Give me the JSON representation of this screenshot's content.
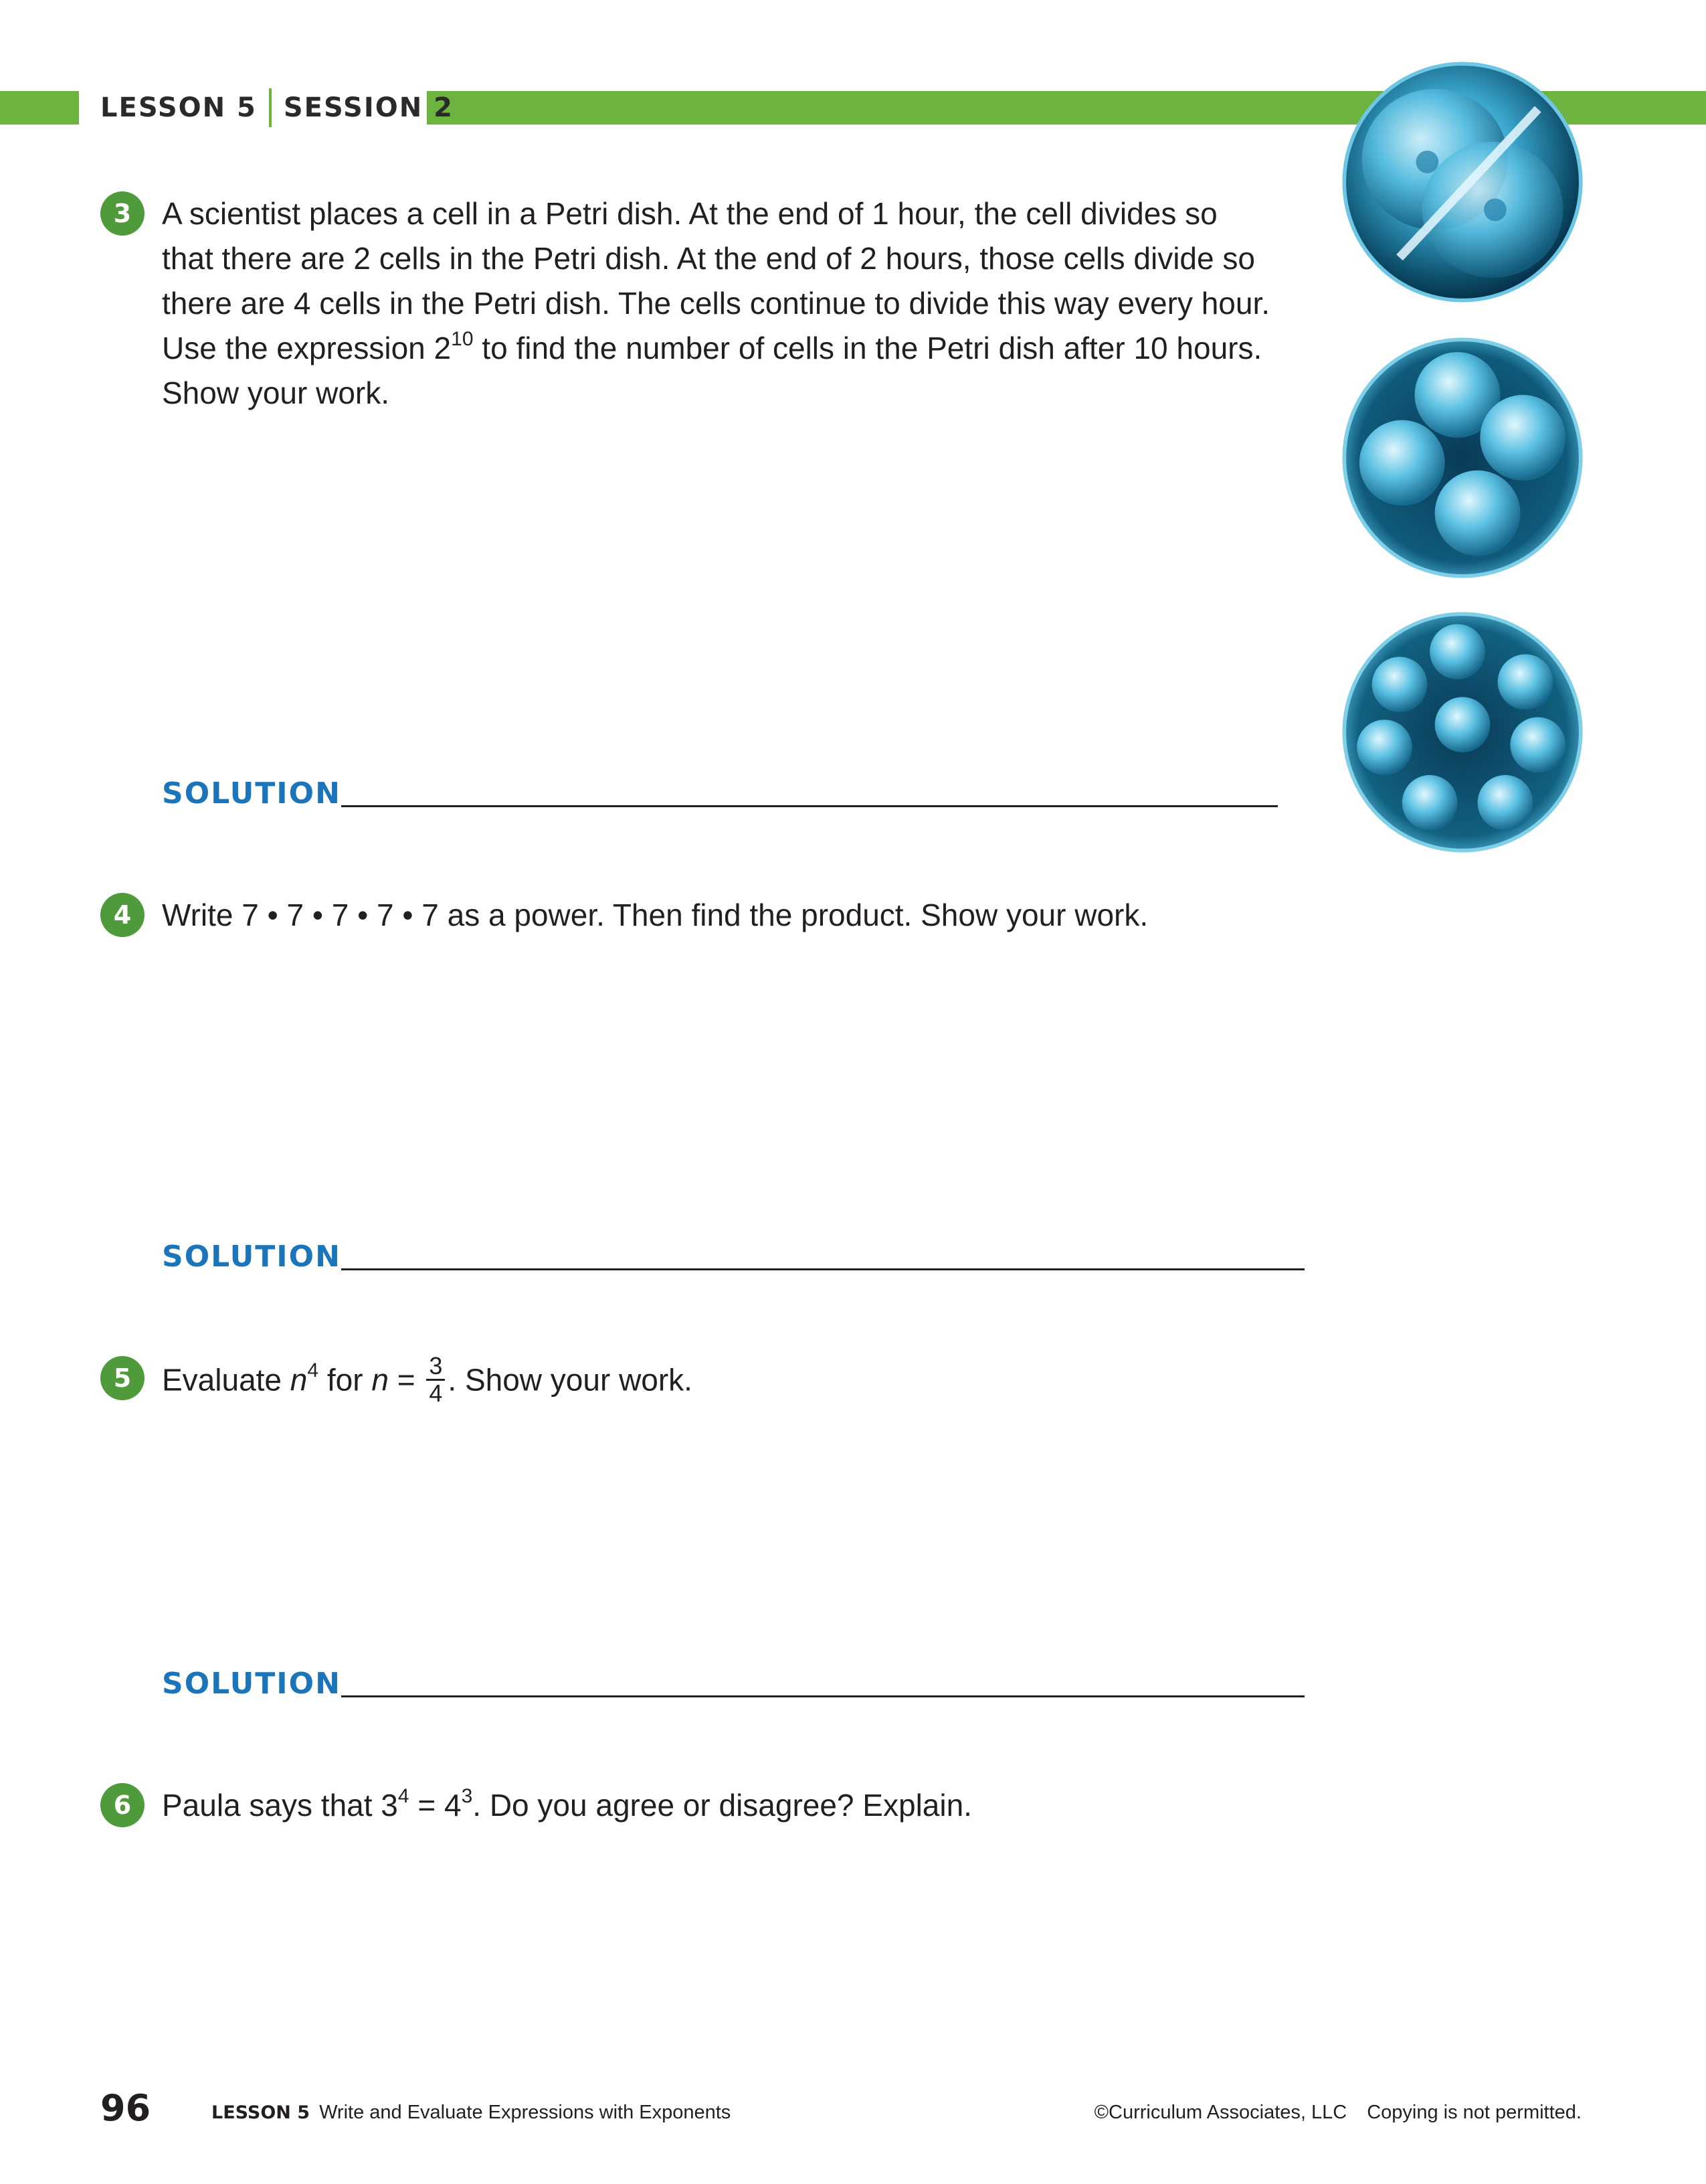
{
  "header": {
    "lesson": "LESSON 5",
    "session": "SESSION 2"
  },
  "colors": {
    "accent_green": "#6db33f",
    "badge_green": "#4f9a3a",
    "solution_blue": "#1a75bb"
  },
  "problems": [
    {
      "number": "3",
      "lines": [
        "A scientist places a cell in a Petri dish. At the end of 1 hour, the cell divides so",
        "that there are 2 cells in the Petri dish. At the end of 2 hours, those cells divide so",
        "there are 4 cells in the Petri dish. The cells continue to divide this way every hour."
      ],
      "line4_before": "Use the expression 2",
      "line4_exp": "10",
      "line4_after": " to find the number of cells in the Petri dish after 10 hours.",
      "line5": "Show your work."
    },
    {
      "number": "4",
      "text": "Write 7 • 7 • 7 • 7 • 7 as a power. Then find the product. Show your work."
    },
    {
      "number": "5",
      "t1": "Evaluate ",
      "var": "n",
      "exp": "4",
      "t2": " for ",
      "var2": "n",
      "eq": " = ",
      "frac_num": "3",
      "frac_den": "4",
      "t3": ". Show your work."
    },
    {
      "number": "6",
      "t1": "Paula says that 3",
      "exp1": "4",
      "t2": " = 4",
      "exp2": "3",
      "t3": ". Do you agree or disagree? Explain."
    }
  ],
  "solution_label": "SOLUTION",
  "footer": {
    "page_number": "96",
    "lesson_label": "LESSON 5",
    "lesson_title": "Write and Evaluate Expressions with Exponents",
    "copyright": "©Curriculum Associates, LLC",
    "notice": "Copying is not permitted."
  },
  "images": [
    {
      "name": "cell-two-division-icon"
    },
    {
      "name": "cell-four-division-icon"
    },
    {
      "name": "cell-eight-division-icon"
    }
  ]
}
